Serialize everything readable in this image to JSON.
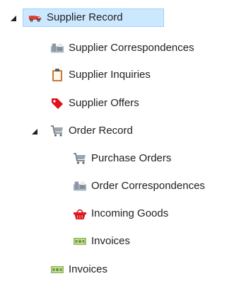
{
  "tree": {
    "root": {
      "label": "Supplier Record",
      "icon": "truck-icon",
      "expanded": true,
      "selected": true,
      "children": [
        {
          "label": "Supplier Correspondences",
          "icon": "fax-icon"
        },
        {
          "label": "Supplier Inquiries",
          "icon": "clipboard-icon"
        },
        {
          "label": "Supplier Offers",
          "icon": "price-tag-icon"
        },
        {
          "label": "Order Record",
          "icon": "shopping-cart-icon",
          "expanded": true,
          "children": [
            {
              "label": "Purchase Orders",
              "icon": "shopping-cart-icon"
            },
            {
              "label": "Order Correspondences",
              "icon": "fax-icon"
            },
            {
              "label": "Incoming Goods",
              "icon": "basket-icon"
            },
            {
              "label": "Invoices",
              "icon": "money-icon"
            }
          ]
        },
        {
          "label": "Invoices",
          "icon": "money-icon"
        }
      ]
    }
  },
  "colors": {
    "selection_bg": "#cce8ff",
    "selection_border": "#99d1ff",
    "text": "#1f1f1f",
    "toggle": "#1f1f1f"
  }
}
